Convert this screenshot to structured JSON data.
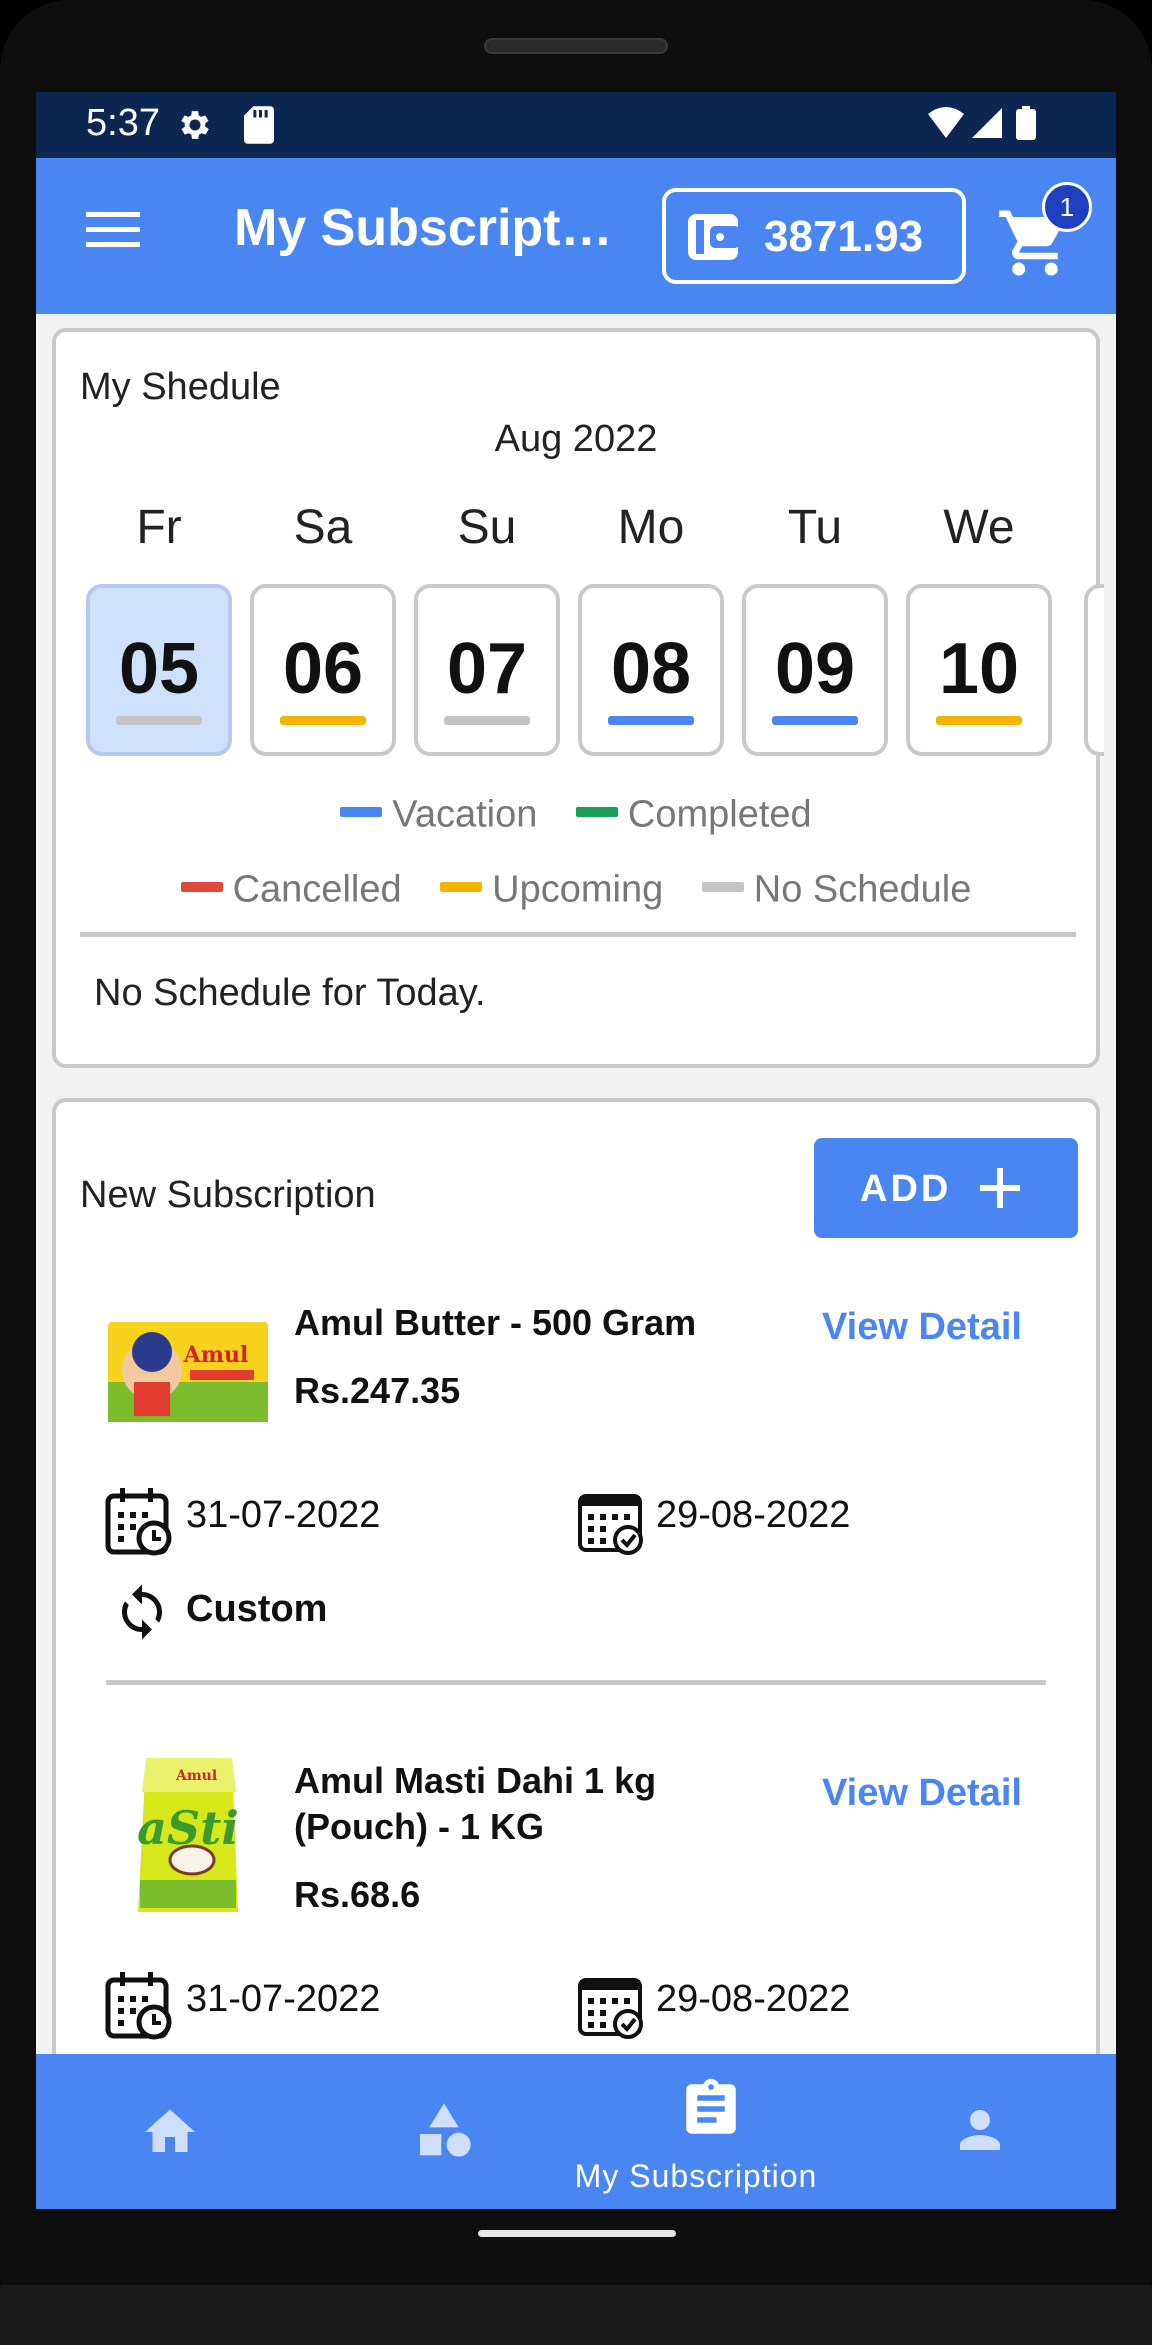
{
  "status_bar": {
    "time": "5:37",
    "icons": [
      "gear-icon",
      "sd-card-icon",
      "wifi-icon",
      "cellular-icon",
      "battery-icon"
    ]
  },
  "app_bar": {
    "title": "My Subscripti…",
    "wallet_amount": "3871.93",
    "cart_count": "1",
    "colors": {
      "primary": "#4a86f1",
      "status_bar": "#0d2753",
      "badge": "#1e3fbf"
    }
  },
  "schedule": {
    "title": "My Shedule",
    "month": "Aug 2022",
    "days": [
      {
        "name": "Fr",
        "num": "05",
        "status": "No Schedule",
        "selected": true
      },
      {
        "name": "Sa",
        "num": "06",
        "status": "Upcoming",
        "selected": false
      },
      {
        "name": "Su",
        "num": "07",
        "status": "No Schedule",
        "selected": false
      },
      {
        "name": "Mo",
        "num": "08",
        "status": "Vacation",
        "selected": false
      },
      {
        "name": "Tu",
        "num": "09",
        "status": "Vacation",
        "selected": false
      },
      {
        "name": "We",
        "num": "10",
        "status": "Upcoming",
        "selected": false
      }
    ],
    "legend": {
      "vacation": "Vacation",
      "completed": "Completed",
      "cancelled": "Cancelled",
      "upcoming": "Upcoming",
      "no_schedule": "No Schedule"
    },
    "legend_colors": {
      "vacation": "#4a86f1",
      "completed": "#1a9e5a",
      "cancelled": "#e2453c",
      "upcoming": "#f4b400",
      "no_schedule": "#c4c4c4"
    },
    "today_message": "No Schedule for Today."
  },
  "subscriptions": {
    "title": "New Subscription",
    "add_label": "ADD",
    "view_detail_label": "View Detail",
    "items": [
      {
        "name": "Amul Butter - 500 Gram",
        "price": "Rs.247.35",
        "start_date": "31-07-2022",
        "end_date": "29-08-2022",
        "frequency": "Custom"
      },
      {
        "name": "Amul Masti Dahi 1 kg (Pouch) - 1 KG",
        "price": "Rs.68.6",
        "start_date": "31-07-2022",
        "end_date": "29-08-2022"
      }
    ]
  },
  "bottom_nav": {
    "items": [
      "home-icon",
      "categories-icon",
      "subscription-icon",
      "profile-icon"
    ],
    "active_label": "My Subscription"
  }
}
